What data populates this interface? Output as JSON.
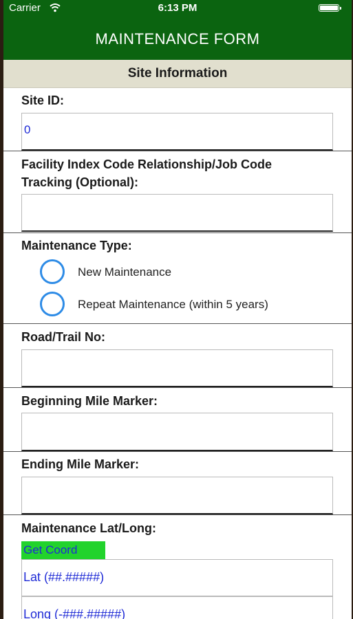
{
  "status_bar": {
    "carrier": "Carrier",
    "time": "6:13 PM"
  },
  "nav": {
    "title": "MAINTENANCE FORM"
  },
  "section": {
    "title": "Site Information"
  },
  "site_id": {
    "label": "Site ID:",
    "value": "0"
  },
  "facility_code": {
    "label_line1": "Facility Index Code Relationship/Job Code",
    "label_line2": "Tracking (Optional):",
    "value": ""
  },
  "maintenance_type": {
    "label": "Maintenance Type:",
    "options": [
      "New Maintenance",
      "Repeat Maintenance (within 5 years)"
    ]
  },
  "road_trail": {
    "label": "Road/Trail No:",
    "value": ""
  },
  "begin_marker": {
    "label": "Beginning Mile Marker:",
    "value": ""
  },
  "end_marker": {
    "label": "Ending Mile Marker:",
    "value": ""
  },
  "latlong": {
    "label": "Maintenance Lat/Long:",
    "button": "Get Coord",
    "lat_placeholder": "Lat (##.#####)",
    "long_placeholder": "Long (-###.#####)"
  },
  "colors": {
    "nav_green": "#0b6410",
    "header_beige": "#e1dfce",
    "button_green": "#22d32c",
    "radio_blue": "#2d8be6",
    "text_blue": "#1f2bd6"
  },
  "icons": {
    "status": [
      "wifi-icon",
      "battery-icon"
    ]
  }
}
